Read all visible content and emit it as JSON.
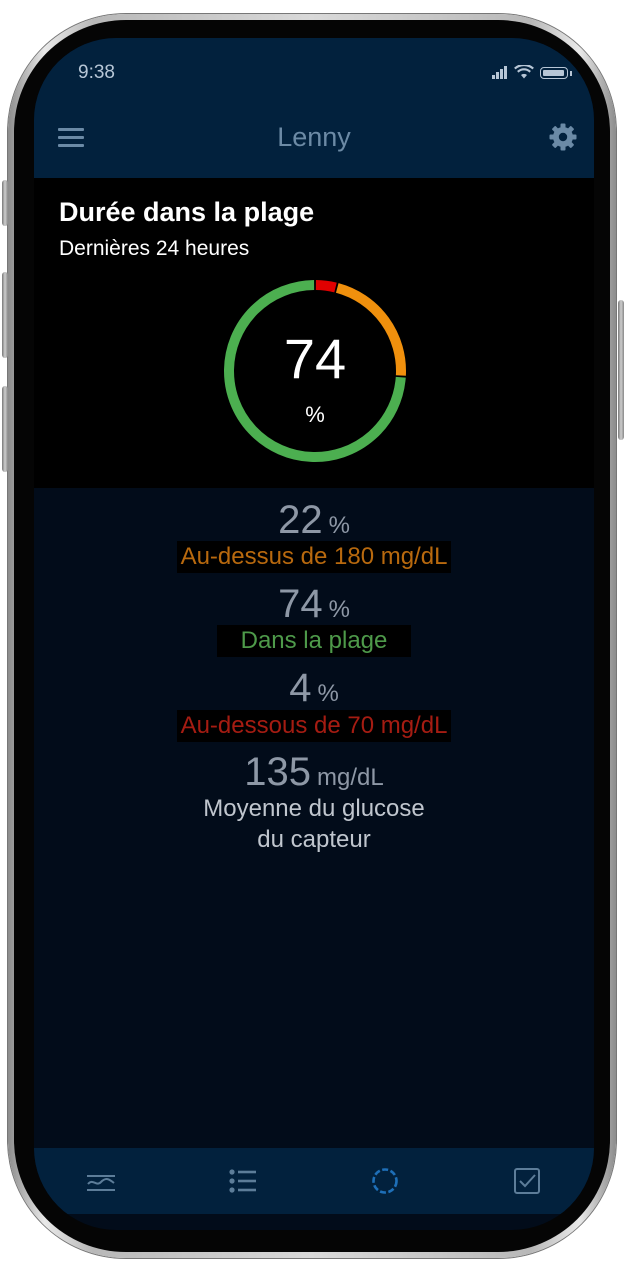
{
  "status_bar": {
    "time": "9:38"
  },
  "header": {
    "title": "Lenny",
    "menu_icon": "hamburger-menu-icon",
    "settings_icon": "gear-icon"
  },
  "summary": {
    "title": "Durée dans la plage",
    "subtitle": "Dernières 24 heures",
    "value": "74",
    "unit": "%",
    "ring_segments": [
      {
        "name": "in-range",
        "percent": 74,
        "color": "#4caf50"
      },
      {
        "name": "below",
        "percent": 4,
        "color": "#e00000"
      },
      {
        "name": "above",
        "percent": 22,
        "color": "#f0900d"
      }
    ]
  },
  "stats": {
    "above": {
      "value": "22",
      "unit": "%",
      "label": "Au-dessus de 180 mg/dL"
    },
    "in_range": {
      "value": "74",
      "unit": "%",
      "label": "Dans la plage"
    },
    "below": {
      "value": "4",
      "unit": "%",
      "label": "Au-dessous de 70 mg/dL"
    },
    "average": {
      "value": "135",
      "unit": "mg/dL",
      "label_line1": "Moyenne du glucose",
      "label_line2": "du capteur"
    }
  },
  "tabbar": {
    "tabs": [
      {
        "icon": "trend-graph-icon",
        "active": false
      },
      {
        "icon": "list-icon",
        "active": false
      },
      {
        "icon": "sensor-ring-icon",
        "active": true
      },
      {
        "icon": "checkbox-icon",
        "active": false
      }
    ],
    "active_color": "#1e6fb8",
    "inactive_color": "#5d7d99"
  }
}
